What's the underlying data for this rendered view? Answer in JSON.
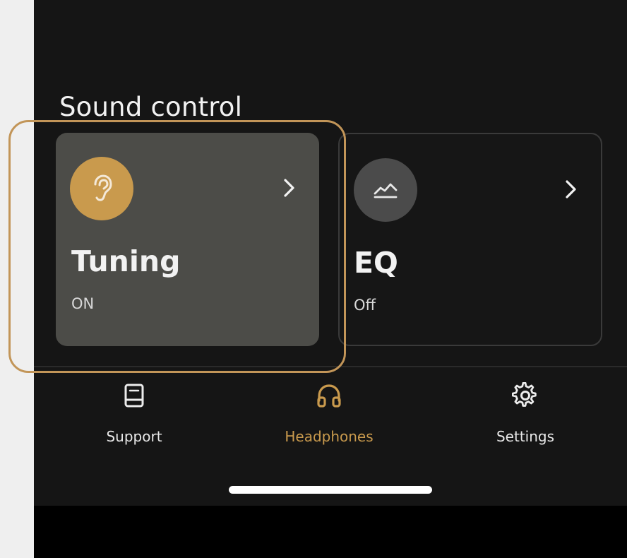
{
  "section": {
    "title": "Sound control"
  },
  "cards": [
    {
      "title": "Tuning",
      "status": "ON",
      "icon": "ear-icon",
      "icon_bg": "#c99a4d",
      "selected": true
    },
    {
      "title": "EQ",
      "status": "Off",
      "icon": "eq-graph-icon",
      "icon_bg": "#4b4b4b",
      "selected": false
    }
  ],
  "nav": {
    "items": [
      {
        "label": "Support",
        "icon": "book-icon",
        "active": false
      },
      {
        "label": "Headphones",
        "icon": "headphones-icon",
        "active": true
      },
      {
        "label": "Settings",
        "icon": "gear-icon",
        "active": false
      }
    ]
  },
  "colors": {
    "accent": "#c99a4d",
    "highlight_border": "#c29558",
    "background": "#151515"
  }
}
